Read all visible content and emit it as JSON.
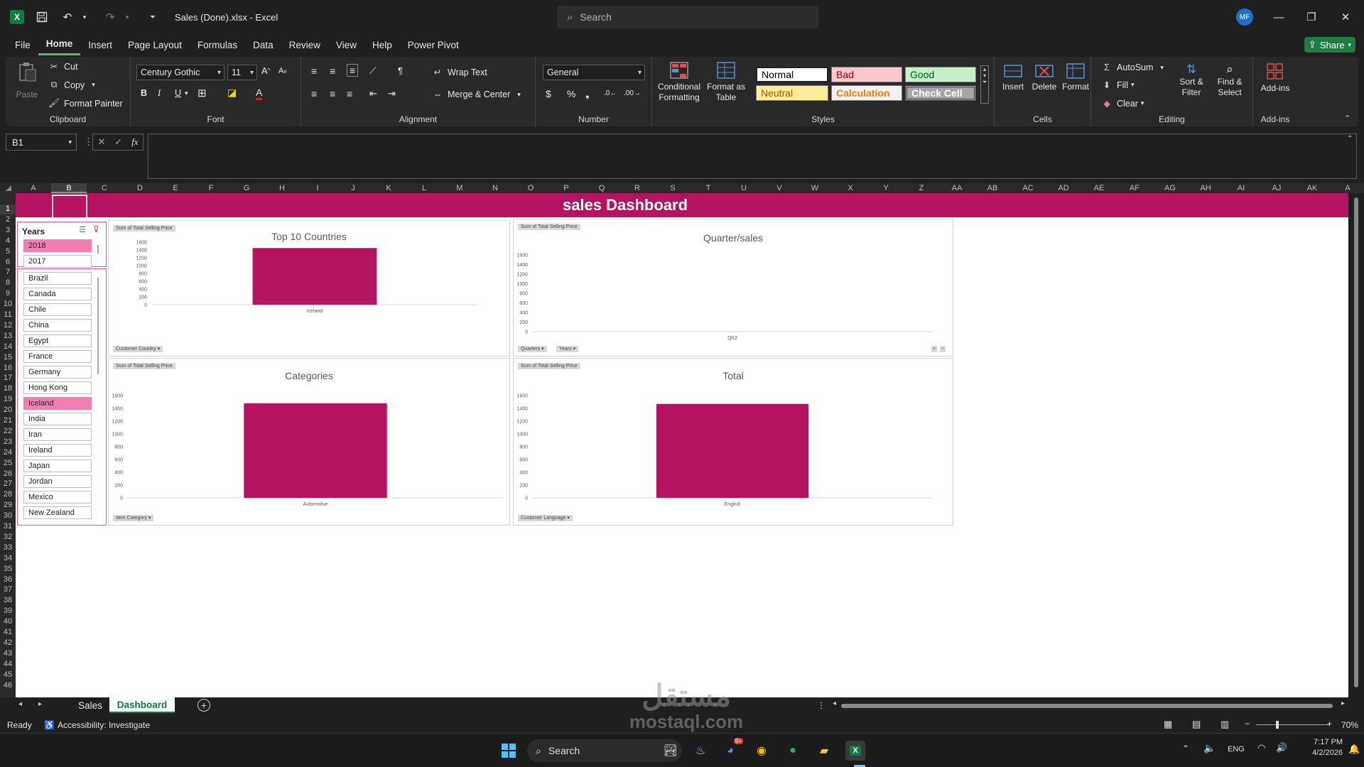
{
  "titlebar": {
    "doc_title": "Sales (Done).xlsx  -  Excel",
    "search_placeholder": "Search",
    "avatar_initials": "MF"
  },
  "menu": [
    "File",
    "Home",
    "Insert",
    "Page Layout",
    "Formulas",
    "Data",
    "Review",
    "View",
    "Help",
    "Power Pivot"
  ],
  "share_label": "Share",
  "ribbon": {
    "clipboard": {
      "paste": "Paste",
      "cut": "Cut",
      "copy": "Copy",
      "format_painter": "Format Painter",
      "label": "Clipboard"
    },
    "font": {
      "name": "Century Gothic",
      "size": "11",
      "label": "Font"
    },
    "alignment": {
      "wrap_text": "Wrap Text",
      "merge_center": "Merge & Center",
      "label": "Alignment"
    },
    "number": {
      "format": "General",
      "label": "Number"
    },
    "styles": {
      "conditional": "Conditional Formatting",
      "format_table": "Format as Table",
      "normal": "Normal",
      "bad": "Bad",
      "good": "Good",
      "neutral": "Neutral",
      "calculation": "Calculation",
      "check_cell": "Check Cell",
      "label": "Styles"
    },
    "cells": {
      "insert": "Insert",
      "delete": "Delete",
      "format": "Format",
      "label": "Cells"
    },
    "editing": {
      "autosum": "AutoSum",
      "fill": "Fill",
      "clear": "Clear",
      "sort_filter": "Sort & Filter",
      "find_select": "Find & Select",
      "label": "Editing"
    },
    "addins": {
      "addins": "Add-ins",
      "label": "Add-ins"
    }
  },
  "formula_bar": {
    "name_box": "B1",
    "fx": "fx",
    "value": ""
  },
  "columns": [
    "A",
    "B",
    "C",
    "D",
    "E",
    "F",
    "G",
    "H",
    "I",
    "J",
    "K",
    "L",
    "M",
    "N",
    "O",
    "P",
    "Q",
    "R",
    "S",
    "T",
    "U",
    "V",
    "W",
    "X",
    "Y",
    "Z",
    "AA",
    "AB",
    "AC",
    "AD",
    "AE",
    "AF",
    "AG",
    "AH",
    "AI",
    "AJ",
    "AK",
    "A"
  ],
  "rows": [
    "1",
    "2",
    "3",
    "4",
    "5",
    "6",
    "7",
    "8",
    "9",
    "10",
    "11",
    "12",
    "13",
    "14",
    "15",
    "16",
    "17",
    "18",
    "19",
    "20",
    "21",
    "22",
    "23",
    "24",
    "25",
    "26",
    "27",
    "28",
    "29",
    "30",
    "31",
    "32",
    "33",
    "34",
    "35",
    "36",
    "37",
    "38",
    "39",
    "40",
    "41",
    "42",
    "43",
    "44",
    "45",
    "46"
  ],
  "dashboard": {
    "title": "sales Dashboard",
    "years_slicer": {
      "title": "Years",
      "items": [
        {
          "label": "2018",
          "selected": true
        },
        {
          "label": "2017",
          "selected": false
        }
      ]
    },
    "country_slicer": {
      "items": [
        {
          "label": "Brazil",
          "selected": false
        },
        {
          "label": "Canada",
          "selected": false
        },
        {
          "label": "Chile",
          "selected": false
        },
        {
          "label": "China",
          "selected": false
        },
        {
          "label": "Egypt",
          "selected": false
        },
        {
          "label": "France",
          "selected": false
        },
        {
          "label": "Germany",
          "selected": false
        },
        {
          "label": "Hong Kong",
          "selected": false
        },
        {
          "label": "Iceland",
          "selected": true
        },
        {
          "label": "India",
          "selected": false
        },
        {
          "label": "Iran",
          "selected": false
        },
        {
          "label": "Ireland",
          "selected": false
        },
        {
          "label": "Japan",
          "selected": false
        },
        {
          "label": "Jordan",
          "selected": false
        },
        {
          "label": "Mexico",
          "selected": false
        },
        {
          "label": "New Zealand",
          "selected": false
        }
      ]
    }
  },
  "chart_data": [
    {
      "type": "bar",
      "title": "Top 10 Countries",
      "value_button": "Sum of Total Selling Price",
      "filter_buttons": [
        "Customer Country"
      ],
      "categories": [
        "Iceland"
      ],
      "values": [
        1450
      ],
      "ylim": [
        0,
        1600
      ],
      "yticks": [
        "1600",
        "1400",
        "1200",
        "1000",
        "800",
        "600",
        "400",
        "200",
        "0"
      ],
      "color": "#b5135f"
    },
    {
      "type": "bar",
      "title": "Quarter/sales",
      "value_button": "Sum of Total Selling Price",
      "filter_buttons": [
        "Quarters",
        "Years"
      ],
      "categories": [
        "Qtr2"
      ],
      "values": [
        0
      ],
      "ylim": [
        0,
        1600
      ],
      "yticks": [
        "1600",
        "1400",
        "1200",
        "1000",
        "800",
        "600",
        "400",
        "200",
        "0"
      ],
      "color": "#b5135f"
    },
    {
      "type": "bar",
      "title": "Categories",
      "value_button": "Sum of Total Selling Price",
      "filter_buttons": [
        "Item Category"
      ],
      "categories": [
        "Automotive"
      ],
      "values": [
        1480
      ],
      "ylim": [
        0,
        1600
      ],
      "yticks": [
        "1600",
        "1400",
        "1200",
        "1000",
        "800",
        "600",
        "400",
        "200",
        "0"
      ],
      "color": "#b5135f"
    },
    {
      "type": "bar",
      "title": "Total",
      "value_button": "Sum of Total Selling Price",
      "filter_buttons": [
        "Customer Language"
      ],
      "categories": [
        "English"
      ],
      "values": [
        1470
      ],
      "ylim": [
        0,
        1600
      ],
      "yticks": [
        "1600",
        "1400",
        "1200",
        "1000",
        "800",
        "600",
        "400",
        "200",
        "0"
      ],
      "color": "#b5135f"
    }
  ],
  "sheet_tabs": [
    {
      "label": "Sales",
      "active": false
    },
    {
      "label": "Dashboard",
      "active": true
    }
  ],
  "status": {
    "ready": "Ready",
    "accessibility": "Accessibility: Investigate",
    "zoom": "70%"
  },
  "taskbar": {
    "search": "Search",
    "lang": "ENG",
    "time": "7:17 PM",
    "date": "4/2/2026",
    "discord_badge": "9+"
  },
  "watermark": {
    "arabic": "مستقل",
    "latin": "mostaql.com"
  }
}
